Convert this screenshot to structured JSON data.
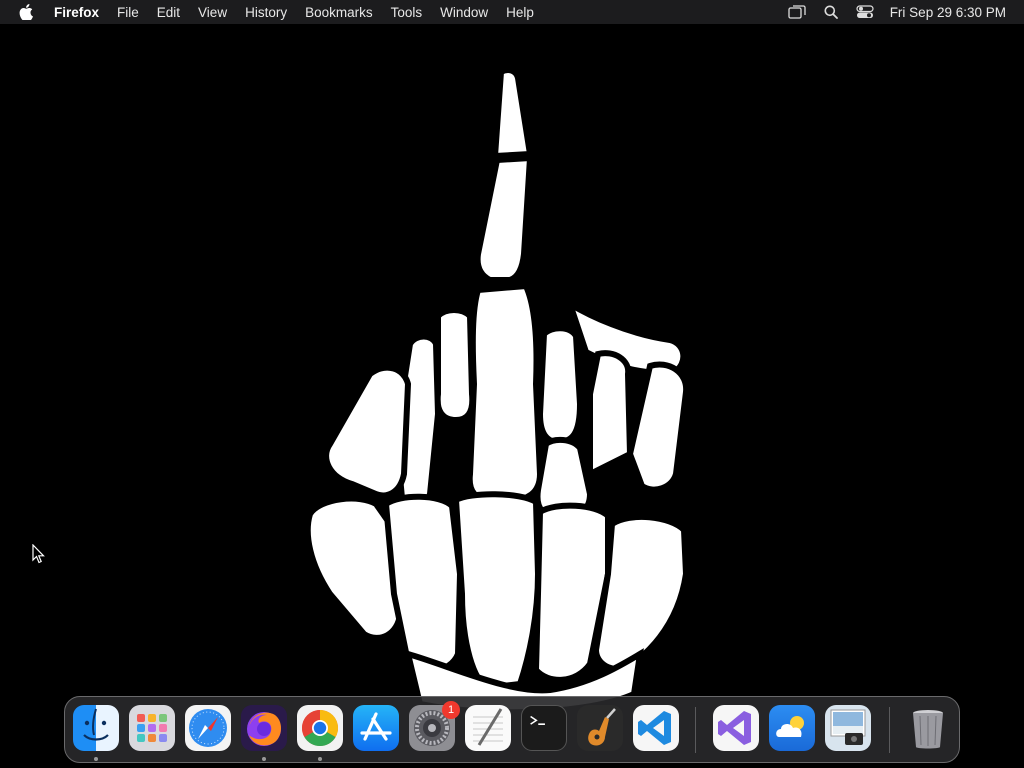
{
  "menubar": {
    "app_name": "Firefox",
    "menus": [
      "File",
      "Edit",
      "View",
      "History",
      "Bookmarks",
      "Tools",
      "Window",
      "Help"
    ],
    "clock": "Fri Sep 29  6:30 PM"
  },
  "dock": {
    "apps": [
      {
        "name": "Finder",
        "running": true
      },
      {
        "name": "Launchpad",
        "running": false
      },
      {
        "name": "Safari",
        "running": false
      },
      {
        "name": "Firefox",
        "running": true
      },
      {
        "name": "Google Chrome",
        "running": true
      },
      {
        "name": "App Store",
        "running": false
      },
      {
        "name": "System Settings",
        "running": false,
        "badge": "1"
      },
      {
        "name": "TextEdit",
        "running": false
      },
      {
        "name": "Terminal",
        "running": false
      },
      {
        "name": "GarageBand",
        "running": false
      },
      {
        "name": "Visual Studio Code",
        "running": false
      },
      {
        "name": "Visual Studio",
        "running": false
      },
      {
        "name": "Weather",
        "running": false
      },
      {
        "name": "Preview",
        "running": false
      },
      {
        "name": "Trash",
        "running": false
      }
    ]
  },
  "colors": {
    "menubar": "#1c1c1e",
    "wallpaper": "#000000",
    "badge": "#f0392e"
  }
}
